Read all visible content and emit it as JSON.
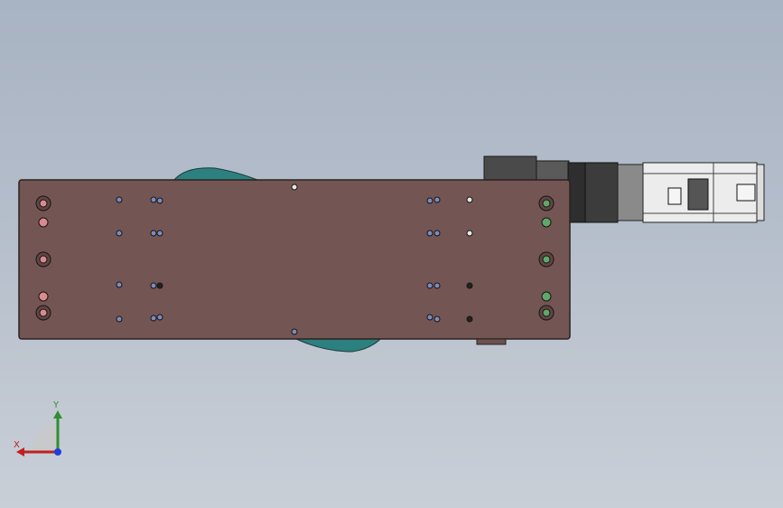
{
  "view": {
    "background_top": "#a8b3c3",
    "background_bottom": "#c9cfd7"
  },
  "colors": {
    "plate": "#735553",
    "plate_edge": "#2a2220",
    "carriage": "#2c8180",
    "motor_dark": "#3a3a3a",
    "motor_body": "#9a9a9a",
    "encoder_body": "#eeeeee",
    "hole_pink": "#d98b8e",
    "hole_green": "#5fa86a",
    "hole_blue": "#7a8cc0",
    "axis_x": "#c0201f",
    "axis_y": "#2f8f2f",
    "axis_z": "#1f3fd8"
  },
  "triad": {
    "x_label": "X",
    "y_label": "Y"
  }
}
